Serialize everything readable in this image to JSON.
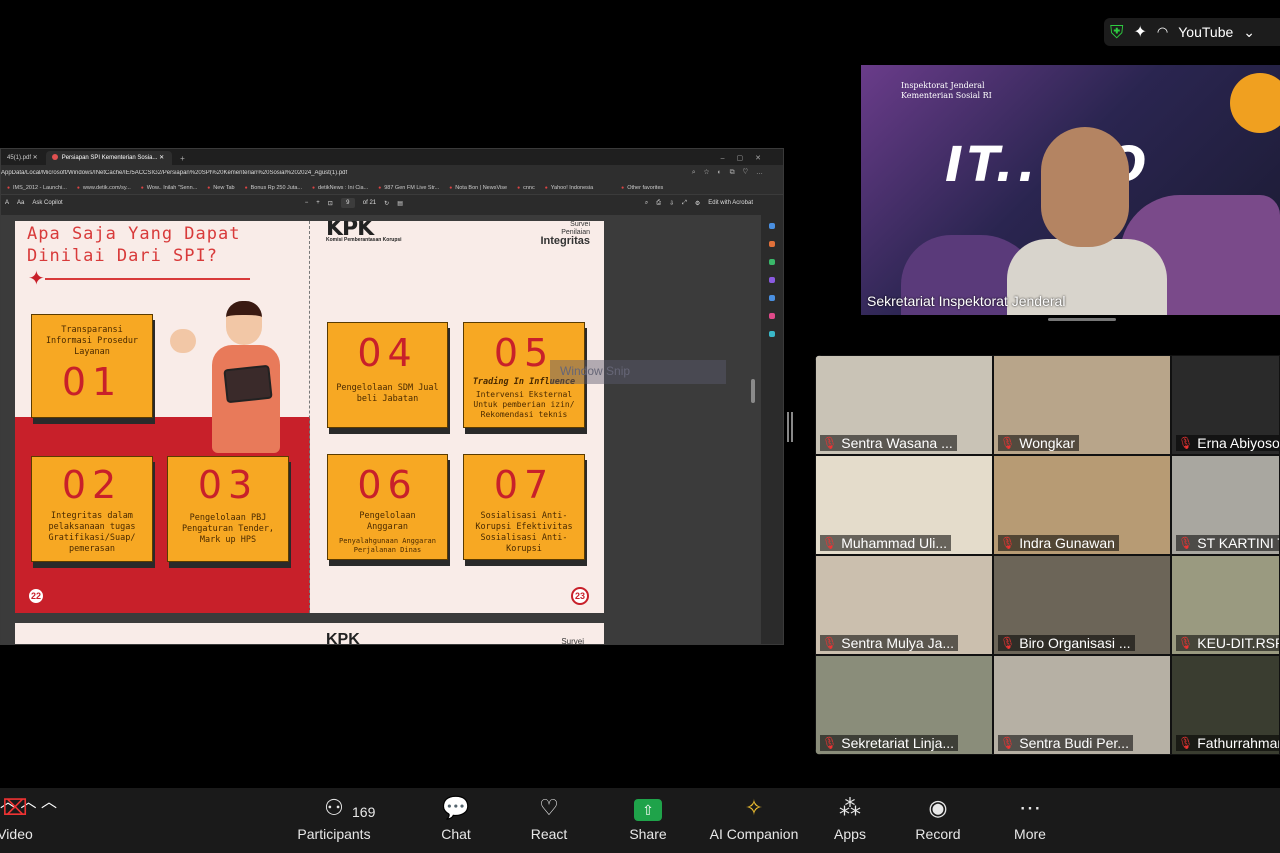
{
  "top_indicator": {
    "youtube_label": "YouTube",
    "shield_icon": "shield-check-icon",
    "spark_icon": "sparkle-icon",
    "cast_icon": "broadcast-icon",
    "caret_icon": "chevron-down-icon"
  },
  "browser": {
    "tabs": [
      {
        "label": "45(1).pdf"
      },
      {
        "label": "Persiapan SPI Kementerian Sosia..."
      }
    ],
    "url": "AppData/Local/Microsoft/Windows/INetCache/IE/5ACCSIG2/Persiapan%20SPI%20Kementerian%20Sosial%202024_Agust(1).pdf",
    "favorites": [
      "IMS_2012 - Launchi...",
      "www.detik.com/sy...",
      "Wow.. Inilah \"Senn...",
      "New Tab",
      "Bonus Rp 250 Juta...",
      "detikNews : Ini Cia...",
      "987 Gen FM Live Str...",
      "Nota Bon | NewsVise",
      "cnnc",
      "Yahoo! Indonesia",
      "Other favorites"
    ],
    "pdf_toolbar": {
      "ask_copilot": "Ask Copilot",
      "page": "9",
      "of_pages": "of 21",
      "edit_with_acrobat": "Edit with Acrobat"
    }
  },
  "slide": {
    "title_line1": "Apa Saja Yang Dapat",
    "title_line2": "Dinilai Dari SPI?",
    "kpk": "KPK",
    "kpk_sub": "Komisi Pemberantasan Korupsi",
    "survei_line1": "Survei",
    "survei_line2": "Penilaian",
    "survei_line3": "Integritas",
    "cards": [
      {
        "num": "01",
        "text": "Transparansi Informasi Prosedur Layanan",
        "sub": ""
      },
      {
        "num": "02",
        "text": "Integritas dalam pelaksanaan tugas Gratifikasi/Suap/ pemerasan",
        "sub": ""
      },
      {
        "num": "03",
        "text": "Pengelolaan PBJ Pengaturan Tender, Mark up HPS",
        "sub": ""
      },
      {
        "num": "04",
        "text": "Pengelolaan SDM Jual beli Jabatan",
        "sub": ""
      },
      {
        "num": "05",
        "text": "Trading In Influence",
        "sub": "Intervensi Eksternal Untuk pemberian izin/ Rekomendasi teknis"
      },
      {
        "num": "06",
        "text": "Pengelolaan Anggaran",
        "sub": "Penyalahgunaan Anggaran Perjalanan Dinas"
      },
      {
        "num": "07",
        "text": "Sosialisasi Anti-Korupsi Efektivitas Sosialisasi Anti-Korupsi",
        "sub": ""
      }
    ],
    "page_left": "22",
    "page_right": "23",
    "next_kpk": "KPK",
    "next_survei": "Survei"
  },
  "snip_label": "Window Snip",
  "speaker": {
    "org_line1": "Inspektorat Jenderal",
    "org_line2": "Kementerian Sosial RI",
    "banner": "IT...GO",
    "name": "Sekretariat Inspektorat Jenderal"
  },
  "participants": [
    {
      "name": "Sentra Wasana ...",
      "bg": "#c9c3b6"
    },
    {
      "name": "Wongkar",
      "bg": "#b8a58a"
    },
    {
      "name": "Erna Abiyoso",
      "bg": "#2a2a2a"
    },
    {
      "name": "Muhammad Uli...",
      "bg": "#e4dccb"
    },
    {
      "name": "Indra Gunawan",
      "bg": "#b79b74"
    },
    {
      "name": "ST KARTINI T",
      "bg": "#a9a7a0"
    },
    {
      "name": "Sentra Mulya Ja...",
      "bg": "#cbbfae"
    },
    {
      "name": "Biro Organisasi ...",
      "bg": "#6c6558"
    },
    {
      "name": "KEU-DIT.RSPI",
      "bg": "#9a9a80"
    },
    {
      "name": "Sekretariat Linja...",
      "bg": "#8a8d7a"
    },
    {
      "name": "Sentra Budi Per...",
      "bg": "#b6b0a4"
    },
    {
      "name": "Fathurrahman",
      "bg": "#3a3d30"
    }
  ],
  "toolbar": {
    "video": "Video",
    "participants": "Participants",
    "participant_count": "169",
    "chat": "Chat",
    "react": "React",
    "share": "Share",
    "ai_companion": "AI Companion",
    "apps": "Apps",
    "record": "Record",
    "more": "More"
  }
}
